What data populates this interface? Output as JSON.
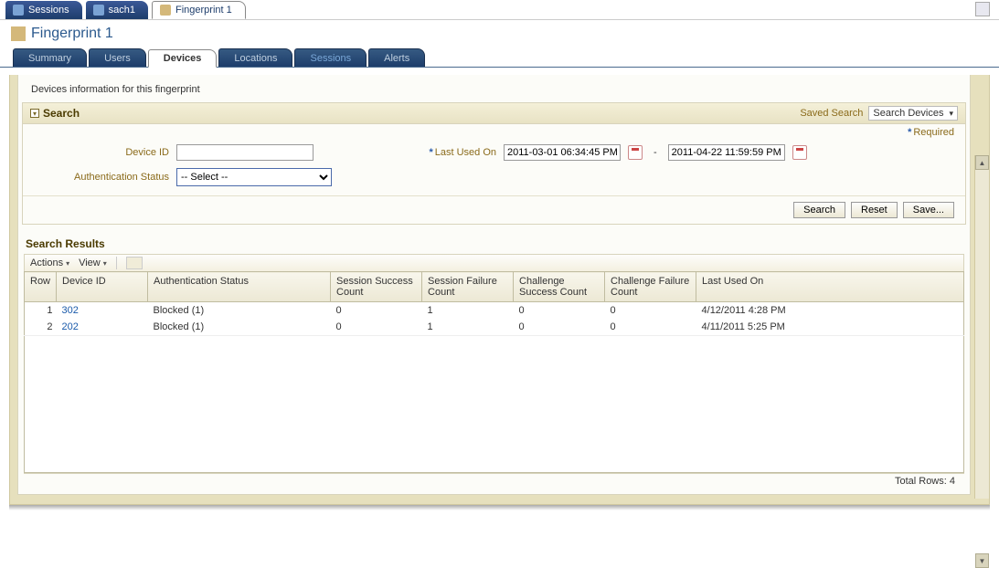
{
  "top_tabs": {
    "sessions": "Sessions",
    "user": "sach1",
    "current": "Fingerprint 1"
  },
  "page_title": "Fingerprint 1",
  "sub_tabs": {
    "summary": "Summary",
    "users": "Users",
    "devices": "Devices",
    "locations": "Locations",
    "sessions": "Sessions",
    "alerts": "Alerts"
  },
  "info_text": "Devices information for this fingerprint",
  "search": {
    "title": "Search",
    "saved_label": "Saved Search",
    "saved_value": "Search Devices",
    "required_text": "Required",
    "device_id_label": "Device ID",
    "device_id_value": "",
    "auth_status_label": "Authentication Status",
    "auth_status_value": "-- Select --",
    "last_used_label": "Last Used On",
    "date_from": "2011-03-01 06:34:45 PM",
    "date_to": "2011-04-22 11:59:59 PM",
    "btn_search": "Search",
    "btn_reset": "Reset",
    "btn_save": "Save..."
  },
  "results": {
    "title": "Search Results",
    "toolbar": {
      "actions": "Actions",
      "view": "View"
    },
    "columns": {
      "row": "Row",
      "device_id": "Device ID",
      "auth_status": "Authentication Status",
      "sess_success": "Session Success Count",
      "sess_failure": "Session Failure Count",
      "chal_success": "Challenge Success Count",
      "chal_failure": "Challenge Failure Count",
      "last_used": "Last Used On"
    },
    "rows": [
      {
        "n": "1",
        "device_id": "302",
        "auth_status": "Blocked (1)",
        "ss": "0",
        "sf": "1",
        "cs": "0",
        "cf": "0",
        "last": "4/12/2011 4:28 PM"
      },
      {
        "n": "2",
        "device_id": "202",
        "auth_status": "Blocked (1)",
        "ss": "0",
        "sf": "1",
        "cs": "0",
        "cf": "0",
        "last": "4/11/2011 5:25 PM"
      }
    ],
    "total_label": "Total Rows:",
    "total_value": "4"
  }
}
